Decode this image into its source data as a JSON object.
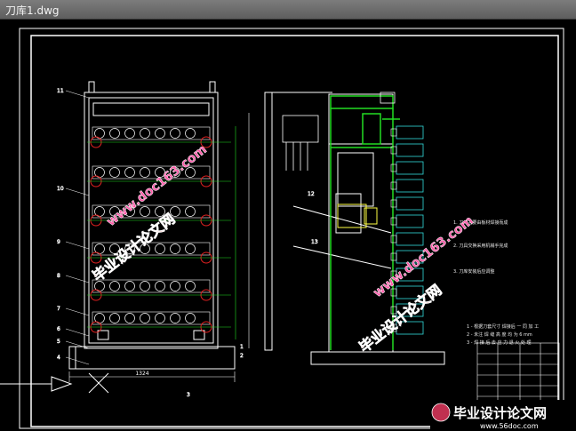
{
  "window": {
    "title": "刀库1.dwg"
  },
  "drawing": {
    "dimension_total_width": "1324",
    "labels_left": [
      "11",
      "10",
      "9",
      "8",
      "7",
      "6",
      "5",
      "4"
    ],
    "labels_right_bottom": [
      "1",
      "2",
      "3"
    ],
    "labels_side": [
      "13",
      "12"
    ],
    "notes": [
      "1. 刀库主要由板材焊接而成",
      "2. 刀具交换采用机械手完成",
      "3. 刀库安装后应调整"
    ],
    "notes_small": [
      "1 - 根据刀套尺寸  焊接后 一 同 加 工",
      "2 - 未注 焊 缝 高 度 均 为 6 mm",
      "3 - 焊 接 后 去 应 力 退 火 处 理"
    ]
  },
  "watermarks": {
    "url": "www.doc163.com",
    "cn": "毕业设计论文网",
    "footer_cn": "毕业设计论文网",
    "footer_url": "www.56doc.com"
  },
  "colors": {
    "line": "#ffffff",
    "green": "#22dd22",
    "cyan": "#33dddd",
    "red": "#e02020",
    "pink": "#ff5aa8",
    "yellow": "#ffff44"
  }
}
